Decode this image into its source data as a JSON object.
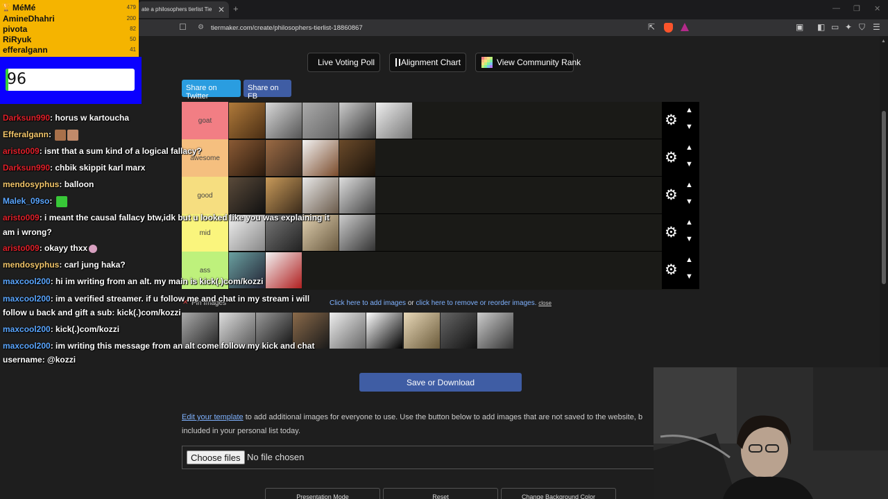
{
  "browser": {
    "tab_title": "ate a philosophers tierlist Tie",
    "tab_close": "✕",
    "new_tab": "+",
    "url": "tiermaker.com/create/philosophers-tierlist-18860867",
    "win_min": "—",
    "win_max": "❐",
    "win_close": "✕"
  },
  "toolbar": {
    "live_poll": "Live Voting Poll",
    "alignment": "Alignment Chart",
    "community": "View Community Rank",
    "share_twitter": "Share on Twitter",
    "share_fb": "Share on FB"
  },
  "tiers": [
    {
      "label": "goat",
      "color": "#f27e84",
      "images": 5
    },
    {
      "label": "awesome",
      "color": "#f5bf7f",
      "images": 4
    },
    {
      "label": "good",
      "color": "#f6de80",
      "images": 4
    },
    {
      "label": "mid",
      "color": "#faf57d",
      "images": 4
    },
    {
      "label": "ass",
      "color": "#bef17c",
      "images": 2
    }
  ],
  "pool": {
    "label": "Pin Images",
    "help_add": "Click here to add images",
    "help_or": " or ",
    "help_remove": "click here to remove or reorder images.",
    "help_close": "close",
    "count": 9
  },
  "save_label": "Save or Download",
  "edit": {
    "link": "Edit your template",
    "text": " to add additional images for everyone to use. Use the button below to add images that are not saved to the website, b included in your personal list today."
  },
  "file": {
    "choose": "Choose files",
    "none": "No file chosen"
  },
  "bottom_buttons": [
    "Presentation Mode",
    "Reset",
    "Change Background Color"
  ],
  "leaderboard": [
    {
      "name": "MéMé",
      "score": "479"
    },
    {
      "name": "AmineDhahri",
      "score": "200"
    },
    {
      "name": "pivota",
      "score": "82"
    },
    {
      "name": "RiRyuk",
      "score": "50"
    },
    {
      "name": "efferalgann",
      "score": "41"
    }
  ],
  "counter": {
    "value": "96",
    "fill": 0.02
  },
  "chat": [
    {
      "user": "Darksun990",
      "color": "#e0202a",
      "text": ": horus w kartoucha"
    },
    {
      "user": "Efferalgann",
      "color": "#f3c66a",
      "text": ": "
    },
    {
      "user": "aristo009",
      "color": "#e0202a",
      "text": ": isnt that a sum kind of a logical fallacy?"
    },
    {
      "user": "Darksun990",
      "color": "#e0202a",
      "text": ": chbik skippit karl marx"
    },
    {
      "user": "mendosyphus",
      "color": "#f3c66a",
      "text": ": balloon"
    },
    {
      "user": "Malek_09so",
      "color": "#5aa6ff",
      "text": ": "
    },
    {
      "user": "aristo009",
      "color": "#e0202a",
      "text": ": i meant the causal fallacy btw,idk but u looked like you was explaining it"
    },
    {
      "user": "",
      "color": "#fff",
      "text": "am i wrong?"
    },
    {
      "user": "aristo009",
      "color": "#e0202a",
      "text": ": okayy thxx"
    },
    {
      "user": "mendosyphus",
      "color": "#f3c66a",
      "text": ": carl jung haka?"
    },
    {
      "user": "maxcool200",
      "color": "#5aa6ff",
      "text": ": hi im writing from an alt. my main is kick(.)com/kozzi"
    },
    {
      "user": "maxcool200",
      "color": "#5aa6ff",
      "text": ": im a verified streamer. if u follow me and chat in my stream i will"
    },
    {
      "user": "",
      "color": "#fff",
      "text": "follow u back and gift a sub: kick(.)com/kozzi"
    },
    {
      "user": "maxcool200",
      "color": "#5aa6ff",
      "text": ": kick(.)com/kozzi"
    },
    {
      "user": "maxcool200",
      "color": "#5aa6ff",
      "text": ": im writing this message from an alt come follow my kick and chat"
    },
    {
      "user": "",
      "color": "#fff",
      "text": "username: @kozzi"
    }
  ]
}
